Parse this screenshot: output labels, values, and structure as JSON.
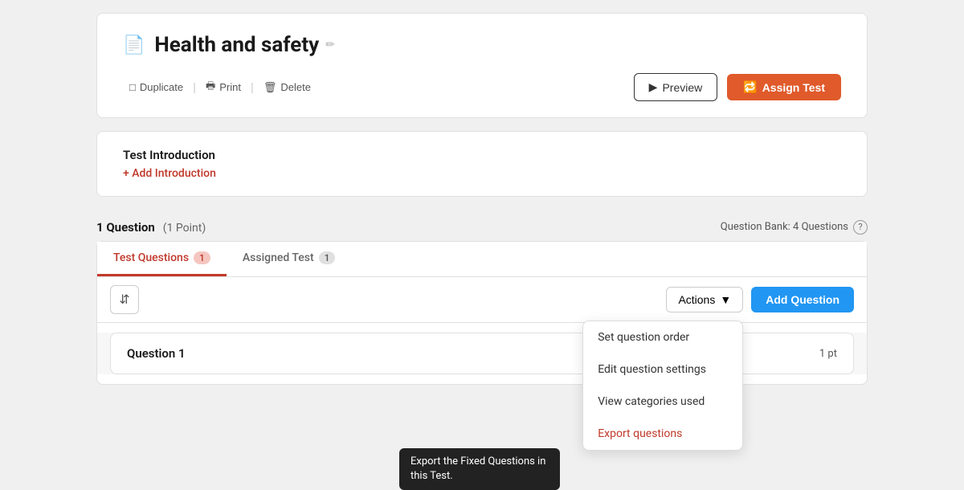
{
  "header": {
    "title": "Health and safety",
    "edit_icon": "✏",
    "doc_icon": "📄",
    "duplicate_label": "Duplicate",
    "print_label": "Print",
    "delete_label": "Delete",
    "preview_label": "Preview",
    "assign_test_label": "Assign Test"
  },
  "intro": {
    "section_title": "Test Introduction",
    "add_link": "+ Add Introduction"
  },
  "questions_bar": {
    "count_label": "1 Question",
    "points_label": "(1 Point)",
    "bank_label": "Question Bank: 4 Questions"
  },
  "tabs": [
    {
      "id": "test-questions",
      "label": "Test Questions",
      "badge": "1",
      "active": true
    },
    {
      "id": "assigned-test",
      "label": "Assigned Test",
      "badge": "1",
      "active": false
    }
  ],
  "toolbar": {
    "actions_label": "Actions",
    "add_question_label": "Add Question"
  },
  "actions_menu": {
    "items": [
      {
        "id": "set-order",
        "label": "Set question order",
        "danger": false
      },
      {
        "id": "edit-settings",
        "label": "Edit question settings",
        "danger": false
      },
      {
        "id": "view-categories",
        "label": "View categories used",
        "danger": false
      },
      {
        "id": "export-questions",
        "label": "Export questions",
        "danger": true
      }
    ]
  },
  "tooltip": {
    "text": "Export the Fixed Questions in this Test."
  },
  "question_row": {
    "label": "Question 1",
    "points": "1 pt"
  }
}
